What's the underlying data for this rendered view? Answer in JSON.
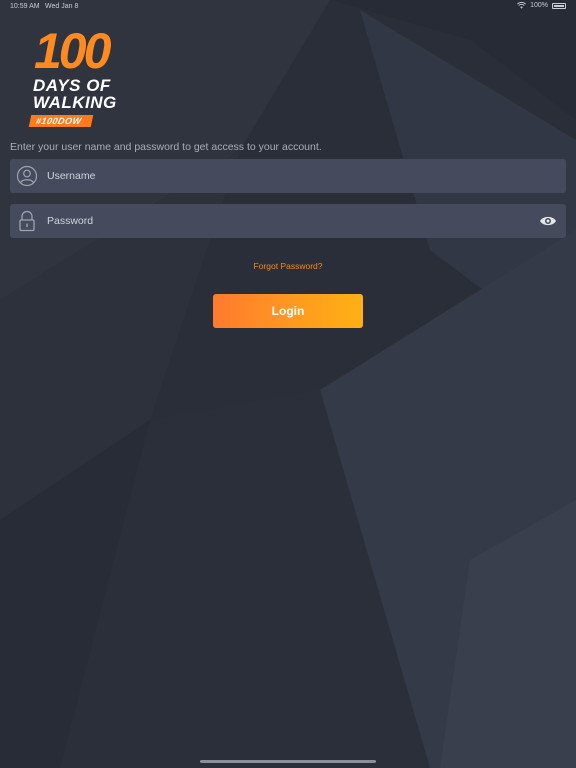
{
  "status_bar": {
    "time": "10:59 AM",
    "date": "Wed Jan 8",
    "battery": "100%",
    "icons": [
      "wifi-icon",
      "battery-icon"
    ]
  },
  "logo": {
    "number": "100",
    "line1": "DAYS OF",
    "line2": "WALKING",
    "hashtag": "#100DOW"
  },
  "instructions": "Enter your user name and password to get access to your account.",
  "username_field": {
    "placeholder": "Username",
    "value": "",
    "icon": "user-icon"
  },
  "password_field": {
    "placeholder": "Password",
    "value": "",
    "icon": "lock-icon",
    "toggle_icon": "eye-icon"
  },
  "forgot_password": "Forgot Password?",
  "login_button": "Login",
  "colors": {
    "background": "#2a2e38",
    "field": "#454b5c",
    "accent_orange": "#ff7a2e",
    "accent_yellow": "#ffb014",
    "link": "#f58a1f"
  }
}
